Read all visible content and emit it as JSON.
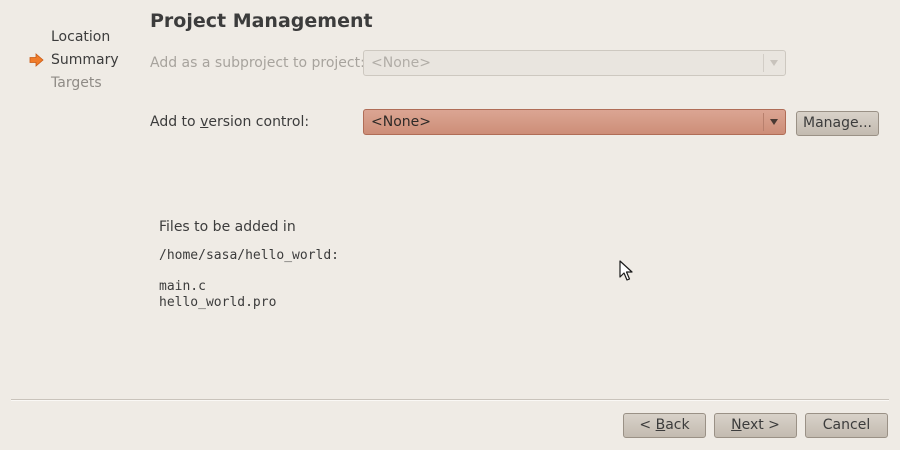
{
  "wizard": {
    "steps": [
      {
        "label": "Location",
        "state": "done"
      },
      {
        "label": "Summary",
        "state": "current"
      },
      {
        "label": "Targets",
        "state": "pending"
      }
    ],
    "current_step_icon": "arrow-right-icon"
  },
  "page": {
    "title": "Project Management"
  },
  "subproject": {
    "label": "Add as a subproject to project:",
    "value": "<None>",
    "enabled": false
  },
  "version_control": {
    "label_pre": "Add to ",
    "label_mnemonic": "v",
    "label_post": "ersion control:",
    "value": "<None>",
    "manage_label": "Manage..."
  },
  "files": {
    "heading": "Files to be added in",
    "directory": "/home/sasa/hello_world:",
    "list": [
      "main.c",
      "hello_world.pro"
    ]
  },
  "footer": {
    "back": {
      "pre": "< ",
      "mnemonic": "B",
      "post": "ack"
    },
    "next": {
      "pre": "",
      "mnemonic": "N",
      "post": "ext >"
    },
    "cancel": "Cancel"
  },
  "colors": {
    "background": "#efebe5",
    "accent_arrow": "#f07c2a",
    "active_combo": "#d39a85"
  }
}
